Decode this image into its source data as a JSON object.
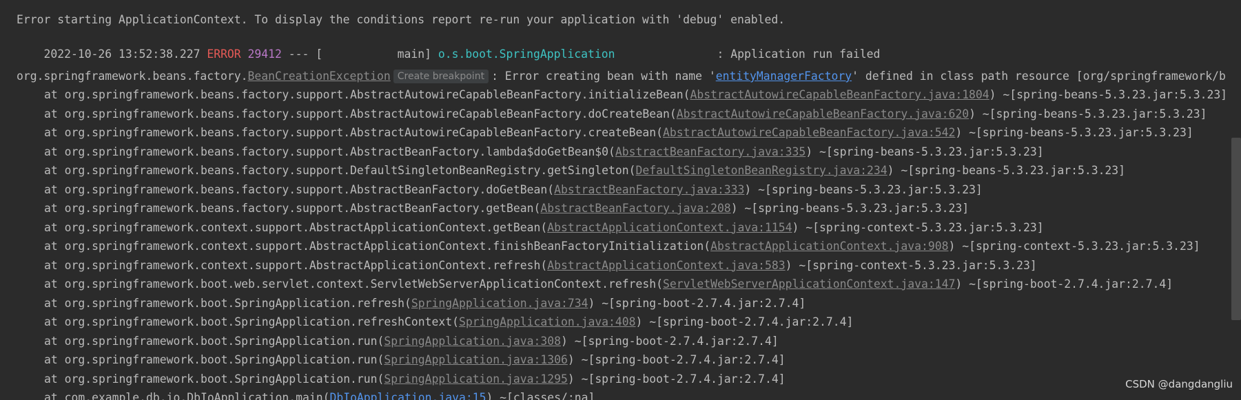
{
  "console": {
    "header_message": "Error starting ApplicationContext. To display the conditions report re-run your application with 'debug' enabled.",
    "log": {
      "timestamp": "2022-10-26 13:52:38.227",
      "level": "ERROR",
      "pid": "29412",
      "sep": "--- [",
      "thread": "           main]",
      "logger": "o.s.boot.SpringApplication",
      "message": ": Application run failed"
    },
    "exception": {
      "prefix": "org.springframework.beans.factory.",
      "class_link": "BeanCreationException",
      "breakpoint_label": "Create breakpoint",
      "message_before": ": Error creating bean with name '",
      "bean_link": "entityManagerFactory",
      "message_after": "' defined in class path resource [org/springframework/b"
    },
    "frames": [
      {
        "method": "at org.springframework.beans.factory.support.AbstractAutowireCapableBeanFactory.initializeBean(",
        "source": "AbstractAutowireCapableBeanFactory.java:1804",
        "jar": ") ~[spring-beans-5.3.23.jar:5.3.23]"
      },
      {
        "method": "at org.springframework.beans.factory.support.AbstractAutowireCapableBeanFactory.doCreateBean(",
        "source": "AbstractAutowireCapableBeanFactory.java:620",
        "jar": ") ~[spring-beans-5.3.23.jar:5.3.23]"
      },
      {
        "method": "at org.springframework.beans.factory.support.AbstractAutowireCapableBeanFactory.createBean(",
        "source": "AbstractAutowireCapableBeanFactory.java:542",
        "jar": ") ~[spring-beans-5.3.23.jar:5.3.23]"
      },
      {
        "method": "at org.springframework.beans.factory.support.AbstractBeanFactory.lambda$doGetBean$0(",
        "source": "AbstractBeanFactory.java:335",
        "jar": ") ~[spring-beans-5.3.23.jar:5.3.23]"
      },
      {
        "method": "at org.springframework.beans.factory.support.DefaultSingletonBeanRegistry.getSingleton(",
        "source": "DefaultSingletonBeanRegistry.java:234",
        "jar": ") ~[spring-beans-5.3.23.jar:5.3.23]"
      },
      {
        "method": "at org.springframework.beans.factory.support.AbstractBeanFactory.doGetBean(",
        "source": "AbstractBeanFactory.java:333",
        "jar": ") ~[spring-beans-5.3.23.jar:5.3.23]"
      },
      {
        "method": "at org.springframework.beans.factory.support.AbstractBeanFactory.getBean(",
        "source": "AbstractBeanFactory.java:208",
        "jar": ") ~[spring-beans-5.3.23.jar:5.3.23]"
      },
      {
        "method": "at org.springframework.context.support.AbstractApplicationContext.getBean(",
        "source": "AbstractApplicationContext.java:1154",
        "jar": ") ~[spring-context-5.3.23.jar:5.3.23]"
      },
      {
        "method": "at org.springframework.context.support.AbstractApplicationContext.finishBeanFactoryInitialization(",
        "source": "AbstractApplicationContext.java:908",
        "jar": ") ~[spring-context-5.3.23.jar:5.3.23]"
      },
      {
        "method": "at org.springframework.context.support.AbstractApplicationContext.refresh(",
        "source": "AbstractApplicationContext.java:583",
        "jar": ") ~[spring-context-5.3.23.jar:5.3.23]"
      },
      {
        "method": "at org.springframework.boot.web.servlet.context.ServletWebServerApplicationContext.refresh(",
        "source": "ServletWebServerApplicationContext.java:147",
        "jar": ") ~[spring-boot-2.7.4.jar:2.7.4]"
      },
      {
        "method": "at org.springframework.boot.SpringApplication.refresh(",
        "source": "SpringApplication.java:734",
        "jar": ") ~[spring-boot-2.7.4.jar:2.7.4]"
      },
      {
        "method": "at org.springframework.boot.SpringApplication.refreshContext(",
        "source": "SpringApplication.java:408",
        "jar": ") ~[spring-boot-2.7.4.jar:2.7.4]"
      },
      {
        "method": "at org.springframework.boot.SpringApplication.run(",
        "source": "SpringApplication.java:308",
        "jar": ") ~[spring-boot-2.7.4.jar:2.7.4]"
      },
      {
        "method": "at org.springframework.boot.SpringApplication.run(",
        "source": "SpringApplication.java:1306",
        "jar": ") ~[spring-boot-2.7.4.jar:2.7.4]"
      },
      {
        "method": "at org.springframework.boot.SpringApplication.run(",
        "source": "SpringApplication.java:1295",
        "jar": ") ~[spring-boot-2.7.4.jar:2.7.4]"
      },
      {
        "method": "at com.example.db.io.DbIoApplication.main(",
        "source": "DbIoApplication.java:15",
        "jar": ") ~[classes/:na]"
      }
    ],
    "watermark": "CSDN @dangdangliu",
    "colors": {
      "background": "#2b2b2b",
      "text": "#bbbbbb",
      "error": "#e55a56",
      "pid": "#b878c6",
      "logger": "#3ec3c3",
      "link": "#5394ec",
      "source_link": "#8a8a8a"
    }
  }
}
